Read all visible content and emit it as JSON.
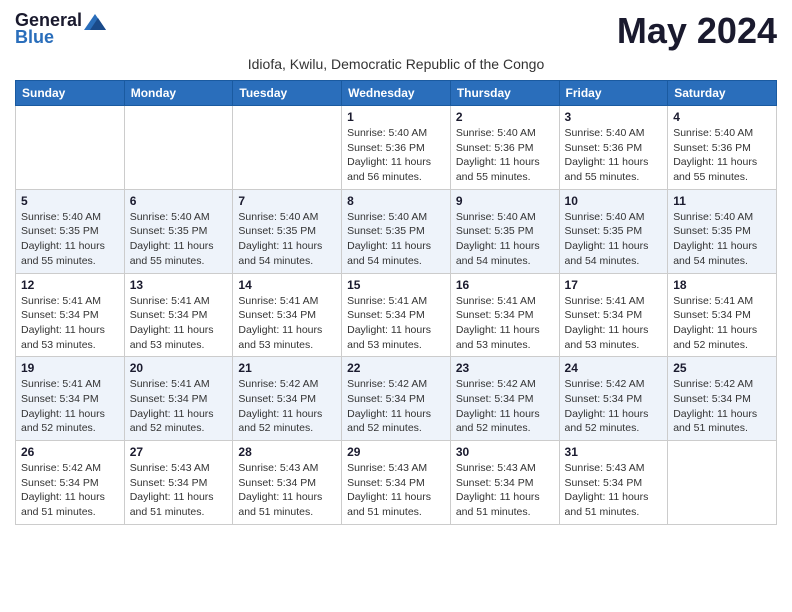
{
  "logo": {
    "general": "General",
    "blue": "Blue"
  },
  "title": "May 2024",
  "subtitle": "Idiofa, Kwilu, Democratic Republic of the Congo",
  "days_of_week": [
    "Sunday",
    "Monday",
    "Tuesday",
    "Wednesday",
    "Thursday",
    "Friday",
    "Saturday"
  ],
  "weeks": [
    [
      {
        "day": "",
        "info": ""
      },
      {
        "day": "",
        "info": ""
      },
      {
        "day": "",
        "info": ""
      },
      {
        "day": "1",
        "info": "Sunrise: 5:40 AM\nSunset: 5:36 PM\nDaylight: 11 hours\nand 56 minutes."
      },
      {
        "day": "2",
        "info": "Sunrise: 5:40 AM\nSunset: 5:36 PM\nDaylight: 11 hours\nand 55 minutes."
      },
      {
        "day": "3",
        "info": "Sunrise: 5:40 AM\nSunset: 5:36 PM\nDaylight: 11 hours\nand 55 minutes."
      },
      {
        "day": "4",
        "info": "Sunrise: 5:40 AM\nSunset: 5:36 PM\nDaylight: 11 hours\nand 55 minutes."
      }
    ],
    [
      {
        "day": "5",
        "info": "Sunrise: 5:40 AM\nSunset: 5:35 PM\nDaylight: 11 hours\nand 55 minutes."
      },
      {
        "day": "6",
        "info": "Sunrise: 5:40 AM\nSunset: 5:35 PM\nDaylight: 11 hours\nand 55 minutes."
      },
      {
        "day": "7",
        "info": "Sunrise: 5:40 AM\nSunset: 5:35 PM\nDaylight: 11 hours\nand 54 minutes."
      },
      {
        "day": "8",
        "info": "Sunrise: 5:40 AM\nSunset: 5:35 PM\nDaylight: 11 hours\nand 54 minutes."
      },
      {
        "day": "9",
        "info": "Sunrise: 5:40 AM\nSunset: 5:35 PM\nDaylight: 11 hours\nand 54 minutes."
      },
      {
        "day": "10",
        "info": "Sunrise: 5:40 AM\nSunset: 5:35 PM\nDaylight: 11 hours\nand 54 minutes."
      },
      {
        "day": "11",
        "info": "Sunrise: 5:40 AM\nSunset: 5:35 PM\nDaylight: 11 hours\nand 54 minutes."
      }
    ],
    [
      {
        "day": "12",
        "info": "Sunrise: 5:41 AM\nSunset: 5:34 PM\nDaylight: 11 hours\nand 53 minutes."
      },
      {
        "day": "13",
        "info": "Sunrise: 5:41 AM\nSunset: 5:34 PM\nDaylight: 11 hours\nand 53 minutes."
      },
      {
        "day": "14",
        "info": "Sunrise: 5:41 AM\nSunset: 5:34 PM\nDaylight: 11 hours\nand 53 minutes."
      },
      {
        "day": "15",
        "info": "Sunrise: 5:41 AM\nSunset: 5:34 PM\nDaylight: 11 hours\nand 53 minutes."
      },
      {
        "day": "16",
        "info": "Sunrise: 5:41 AM\nSunset: 5:34 PM\nDaylight: 11 hours\nand 53 minutes."
      },
      {
        "day": "17",
        "info": "Sunrise: 5:41 AM\nSunset: 5:34 PM\nDaylight: 11 hours\nand 53 minutes."
      },
      {
        "day": "18",
        "info": "Sunrise: 5:41 AM\nSunset: 5:34 PM\nDaylight: 11 hours\nand 52 minutes."
      }
    ],
    [
      {
        "day": "19",
        "info": "Sunrise: 5:41 AM\nSunset: 5:34 PM\nDaylight: 11 hours\nand 52 minutes."
      },
      {
        "day": "20",
        "info": "Sunrise: 5:41 AM\nSunset: 5:34 PM\nDaylight: 11 hours\nand 52 minutes."
      },
      {
        "day": "21",
        "info": "Sunrise: 5:42 AM\nSunset: 5:34 PM\nDaylight: 11 hours\nand 52 minutes."
      },
      {
        "day": "22",
        "info": "Sunrise: 5:42 AM\nSunset: 5:34 PM\nDaylight: 11 hours\nand 52 minutes."
      },
      {
        "day": "23",
        "info": "Sunrise: 5:42 AM\nSunset: 5:34 PM\nDaylight: 11 hours\nand 52 minutes."
      },
      {
        "day": "24",
        "info": "Sunrise: 5:42 AM\nSunset: 5:34 PM\nDaylight: 11 hours\nand 52 minutes."
      },
      {
        "day": "25",
        "info": "Sunrise: 5:42 AM\nSunset: 5:34 PM\nDaylight: 11 hours\nand 51 minutes."
      }
    ],
    [
      {
        "day": "26",
        "info": "Sunrise: 5:42 AM\nSunset: 5:34 PM\nDaylight: 11 hours\nand 51 minutes."
      },
      {
        "day": "27",
        "info": "Sunrise: 5:43 AM\nSunset: 5:34 PM\nDaylight: 11 hours\nand 51 minutes."
      },
      {
        "day": "28",
        "info": "Sunrise: 5:43 AM\nSunset: 5:34 PM\nDaylight: 11 hours\nand 51 minutes."
      },
      {
        "day": "29",
        "info": "Sunrise: 5:43 AM\nSunset: 5:34 PM\nDaylight: 11 hours\nand 51 minutes."
      },
      {
        "day": "30",
        "info": "Sunrise: 5:43 AM\nSunset: 5:34 PM\nDaylight: 11 hours\nand 51 minutes."
      },
      {
        "day": "31",
        "info": "Sunrise: 5:43 AM\nSunset: 5:34 PM\nDaylight: 11 hours\nand 51 minutes."
      },
      {
        "day": "",
        "info": ""
      }
    ]
  ]
}
